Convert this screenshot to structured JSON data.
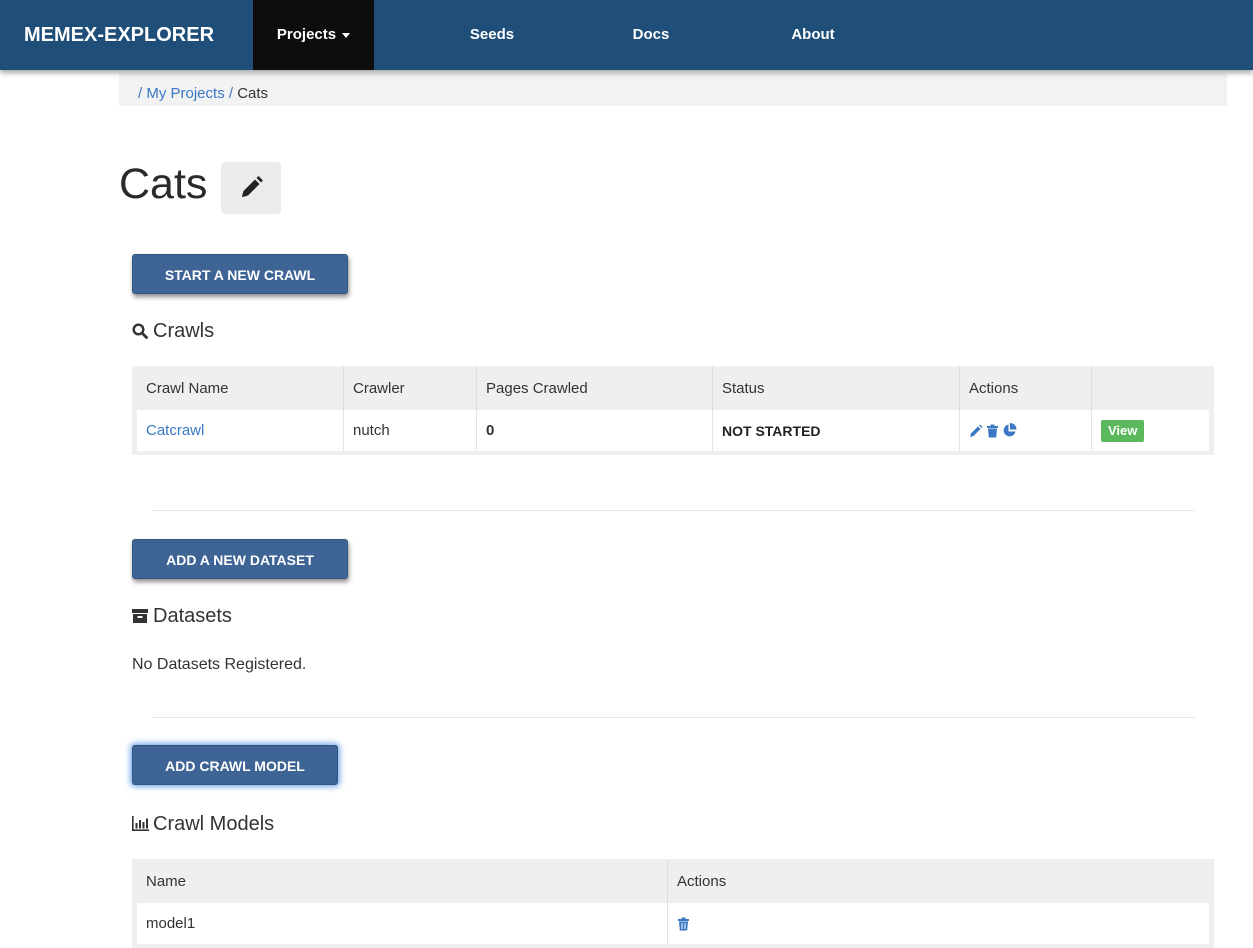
{
  "navbar": {
    "brand": "MEMEX-EXPLORER",
    "items": [
      {
        "label": "Projects",
        "active": true,
        "has_dropdown": true
      },
      {
        "label": "Seeds"
      },
      {
        "label": "Docs"
      },
      {
        "label": "About"
      }
    ],
    "background": "#1f4e79"
  },
  "breadcrumb": {
    "sep1": "/",
    "link": "My Projects",
    "sep2": "/",
    "current": "Cats"
  },
  "page": {
    "title": "Cats",
    "edit_icon": "pencil-icon"
  },
  "crawls": {
    "button": "START A NEW CRAWL",
    "heading": "Crawls",
    "heading_icon": "search-icon",
    "columns": [
      "Crawl Name",
      "Crawler",
      "Pages Crawled",
      "Status",
      "Actions",
      ""
    ],
    "rows": [
      {
        "name": "Catcrawl",
        "crawler": "nutch",
        "pages": "0",
        "status": "NOT STARTED",
        "actions": [
          "pencil-icon",
          "trash-icon",
          "pie-chart-icon"
        ],
        "view": "View"
      }
    ]
  },
  "datasets": {
    "button": "ADD A NEW DATASET",
    "heading": "Datasets",
    "heading_icon": "archive-icon",
    "empty_text": "No Datasets Registered."
  },
  "models": {
    "button": "ADD CRAWL MODEL",
    "heading": "Crawl Models",
    "heading_icon": "bar-chart-icon",
    "columns": [
      "Name",
      "Actions"
    ],
    "rows": [
      {
        "name": "model1",
        "actions": [
          "trash-icon"
        ]
      }
    ]
  },
  "colors": {
    "accent_button": "#3d6494",
    "link": "#3a78c3",
    "view_button": "#5cb85c"
  }
}
